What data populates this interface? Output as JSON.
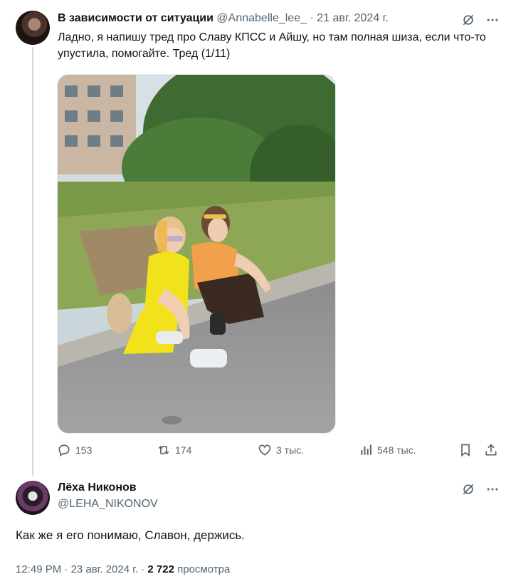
{
  "tweet1": {
    "author_name": "В зависимости от ситуации",
    "handle": "@Annabelle_lee_",
    "separator": "·",
    "date": "21 авг. 2024 г.",
    "text": "Ладно, я напишу тред про Славу КПСС и Айшу, но там полная шиза, если что-то упустила, помогайте. Тред (1/11)",
    "replies": "153",
    "reposts": "174",
    "likes": "3 тыс.",
    "views": "548 тыс."
  },
  "tweet2": {
    "author_name": "Лёха Никонов",
    "handle": "@LEHA_NIKONOV",
    "text": "Как же я его понимаю, Славон, держись.",
    "time": "12:49 PM",
    "separator": "·",
    "date": "23 авг. 2024 г.",
    "separator2": "·",
    "views_count": "2 722",
    "views_label": "просмотра"
  },
  "icons": {
    "grok": "grok-icon",
    "more": "more-icon",
    "reply": "reply-icon",
    "repost": "repost-icon",
    "like": "heart-icon",
    "views": "views-icon",
    "bookmark": "bookmark-icon",
    "share": "share-icon"
  },
  "colors": {
    "text_primary": "#0f1419",
    "text_secondary": "#536471",
    "thread_line": "#cfd9de"
  }
}
